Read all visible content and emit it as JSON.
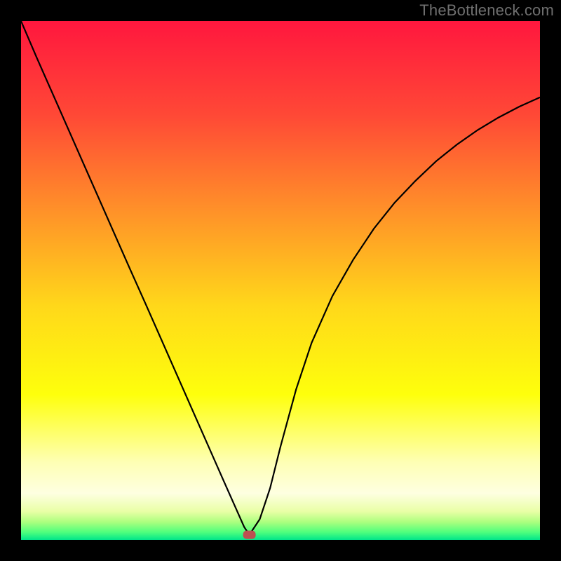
{
  "watermark": "TheBottleneck.com",
  "chart_data": {
    "type": "line",
    "title": "",
    "xlabel": "",
    "ylabel": "",
    "xlim": [
      0,
      1
    ],
    "ylim": [
      0,
      1
    ],
    "marker": {
      "x": 0.44,
      "y": 0.01,
      "color": "#bc5151"
    },
    "background_gradient": {
      "stops": [
        {
          "offset": 0.0,
          "color": "#ff173e"
        },
        {
          "offset": 0.18,
          "color": "#ff4836"
        },
        {
          "offset": 0.35,
          "color": "#ff8b2a"
        },
        {
          "offset": 0.55,
          "color": "#ffd81a"
        },
        {
          "offset": 0.72,
          "color": "#feff0c"
        },
        {
          "offset": 0.85,
          "color": "#feffb4"
        },
        {
          "offset": 0.91,
          "color": "#feffe1"
        },
        {
          "offset": 0.945,
          "color": "#e9ffa6"
        },
        {
          "offset": 0.965,
          "color": "#aeff7f"
        },
        {
          "offset": 0.985,
          "color": "#4fff7d"
        },
        {
          "offset": 1.0,
          "color": "#00e58a"
        }
      ]
    },
    "series": [
      {
        "name": "curve",
        "color": "#000000",
        "x": [
          0.0,
          0.03,
          0.06,
          0.09,
          0.12,
          0.15,
          0.18,
          0.21,
          0.24,
          0.27,
          0.3,
          0.33,
          0.36,
          0.39,
          0.41,
          0.43,
          0.44,
          0.46,
          0.48,
          0.5,
          0.53,
          0.56,
          0.6,
          0.64,
          0.68,
          0.72,
          0.76,
          0.8,
          0.84,
          0.88,
          0.92,
          0.96,
          1.0
        ],
        "y": [
          1.0,
          0.93,
          0.862,
          0.794,
          0.726,
          0.658,
          0.59,
          0.522,
          0.455,
          0.387,
          0.319,
          0.251,
          0.183,
          0.115,
          0.07,
          0.025,
          0.01,
          0.04,
          0.1,
          0.18,
          0.29,
          0.38,
          0.47,
          0.54,
          0.6,
          0.65,
          0.692,
          0.73,
          0.762,
          0.79,
          0.814,
          0.835,
          0.853
        ]
      }
    ]
  }
}
